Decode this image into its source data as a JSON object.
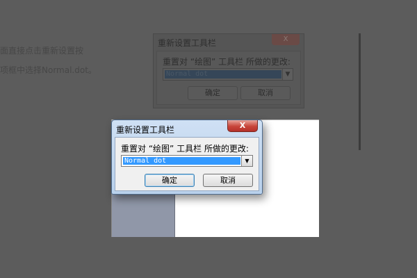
{
  "background": {
    "line1": "面直接点击重新设置按",
    "line2": "项框中选择Normal.dot。"
  },
  "dialog": {
    "title": "重新设置工具栏",
    "close_label": "X",
    "prompt": "重置对 “绘图” 工具栏 所做的更改:",
    "template_value": "Normal dot",
    "dropdown_arrow": "▼",
    "ok_label": "确定",
    "cancel_label": "取消"
  },
  "colors": {
    "title_bar": "#b9d1ec",
    "selection": "#3399ff",
    "close_button": "#c8453a",
    "backdrop": "#5c5c5c"
  },
  "icons": {
    "close": "close-icon",
    "dropdown": "chevron-down-icon"
  }
}
